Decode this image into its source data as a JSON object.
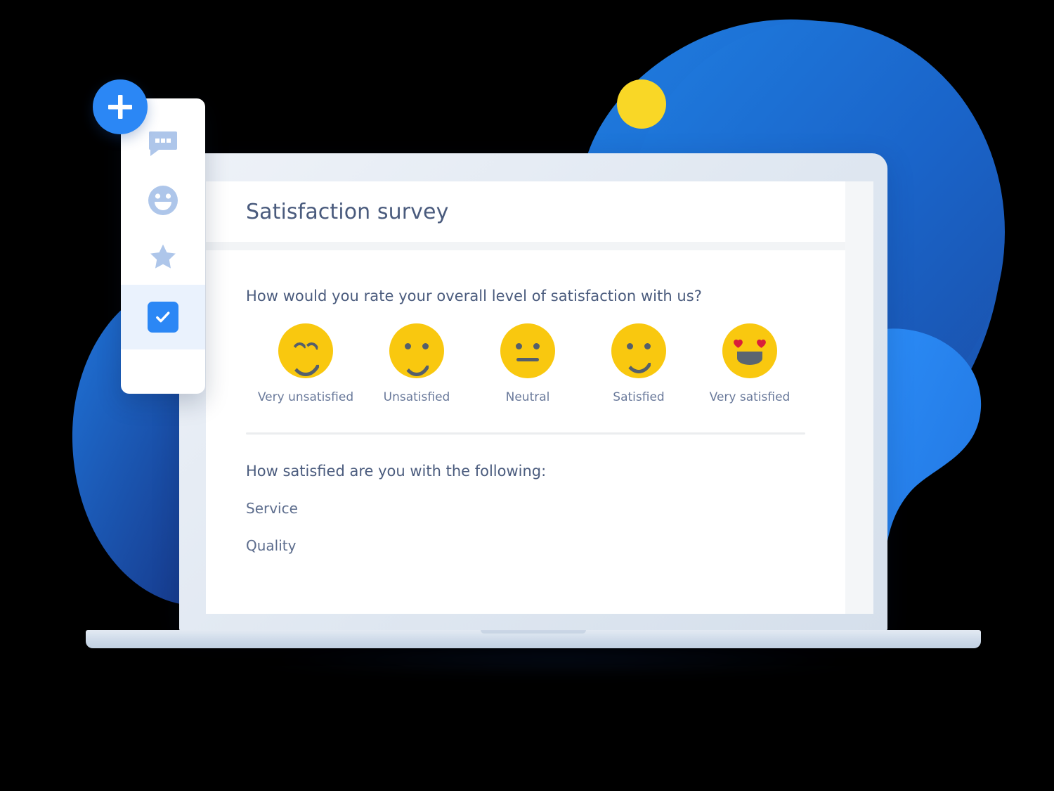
{
  "colors": {
    "brand_blue": "#2b87f5",
    "deep_blue": "#1457b8",
    "mid_blue": "#1769d4",
    "yellow": "#f9d726",
    "emoji_yellow": "#f9c80f",
    "heading_text": "#4a5b7d",
    "body_text": "#5d6d8d",
    "label_text": "#6a7a9b",
    "sidebar_icon": "#aec6ea",
    "sidebar_selected_bg": "#eaf2fd",
    "laptop_body": "#dfe7f1"
  },
  "sidebar": {
    "add_button_label": "+",
    "items": [
      {
        "icon": "chat-bubble-icon",
        "name": "sidebar-item-messages",
        "selected": false
      },
      {
        "icon": "smiley-face-icon",
        "name": "sidebar-item-reactions",
        "selected": false
      },
      {
        "icon": "star-icon",
        "name": "sidebar-item-ratings",
        "selected": false
      },
      {
        "icon": "checkbox-checked-icon",
        "name": "sidebar-item-survey",
        "selected": true
      }
    ]
  },
  "app": {
    "title": "Satisfaction survey",
    "question_main": "How would you rate your overall level of satisfaction with us?",
    "scale": [
      {
        "label": "Very unsatisfied",
        "face": "very-sad-face"
      },
      {
        "label": "Unsatisfied",
        "face": "sad-face"
      },
      {
        "label": "Neutral",
        "face": "neutral-face"
      },
      {
        "label": "Satisfied",
        "face": "happy-face"
      },
      {
        "label": "Very satisfied",
        "face": "heart-eyes-face"
      }
    ],
    "question_secondary": "How satisfied are you with the following:",
    "secondary_items": [
      {
        "label": "Service"
      },
      {
        "label": "Quality"
      }
    ]
  }
}
